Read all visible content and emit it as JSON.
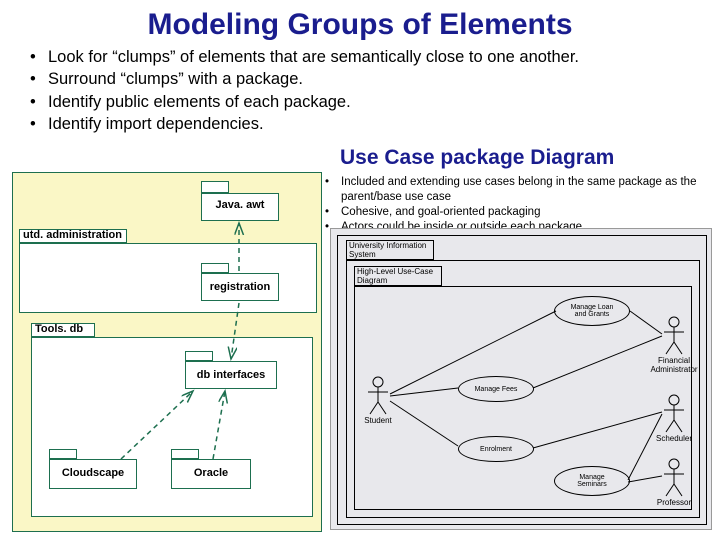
{
  "title": "Modeling Groups of Elements",
  "bullets": [
    "Look for “clumps” of elements that are semantically close to one another.",
    "Surround “clumps” with a package.",
    "Identify public elements of each package.",
    "Identify import dependencies."
  ],
  "subheading": "Use Case package Diagram",
  "sub_bullets": [
    "Included and extending use cases belong in the same package as the parent/base use case",
    "Cohesive, and goal-oriented packaging",
    "Actors could be inside or outside each package"
  ],
  "left_packages": {
    "java_awt": "Java. awt",
    "utd_admin": "utd. administration",
    "registration": "registration",
    "tools_db": "Tools. db",
    "db_interfaces": "db interfaces",
    "cloudscape": "Cloudscape",
    "oracle": "Oracle"
  },
  "ucd": {
    "system_title": "University Information\nSystem",
    "package_title": "High-Level Use-Case\nDiagram",
    "actors": {
      "student": "Student",
      "financial": "Financial\nAdministrator",
      "scheduler": "Scheduler",
      "professor": "Professor"
    },
    "usecases": {
      "loan": "Manage Loan\nand Grants",
      "fees": "Manage Fees",
      "enrolment": "Enrolment",
      "seminars": "Manage\nSeminars"
    }
  }
}
